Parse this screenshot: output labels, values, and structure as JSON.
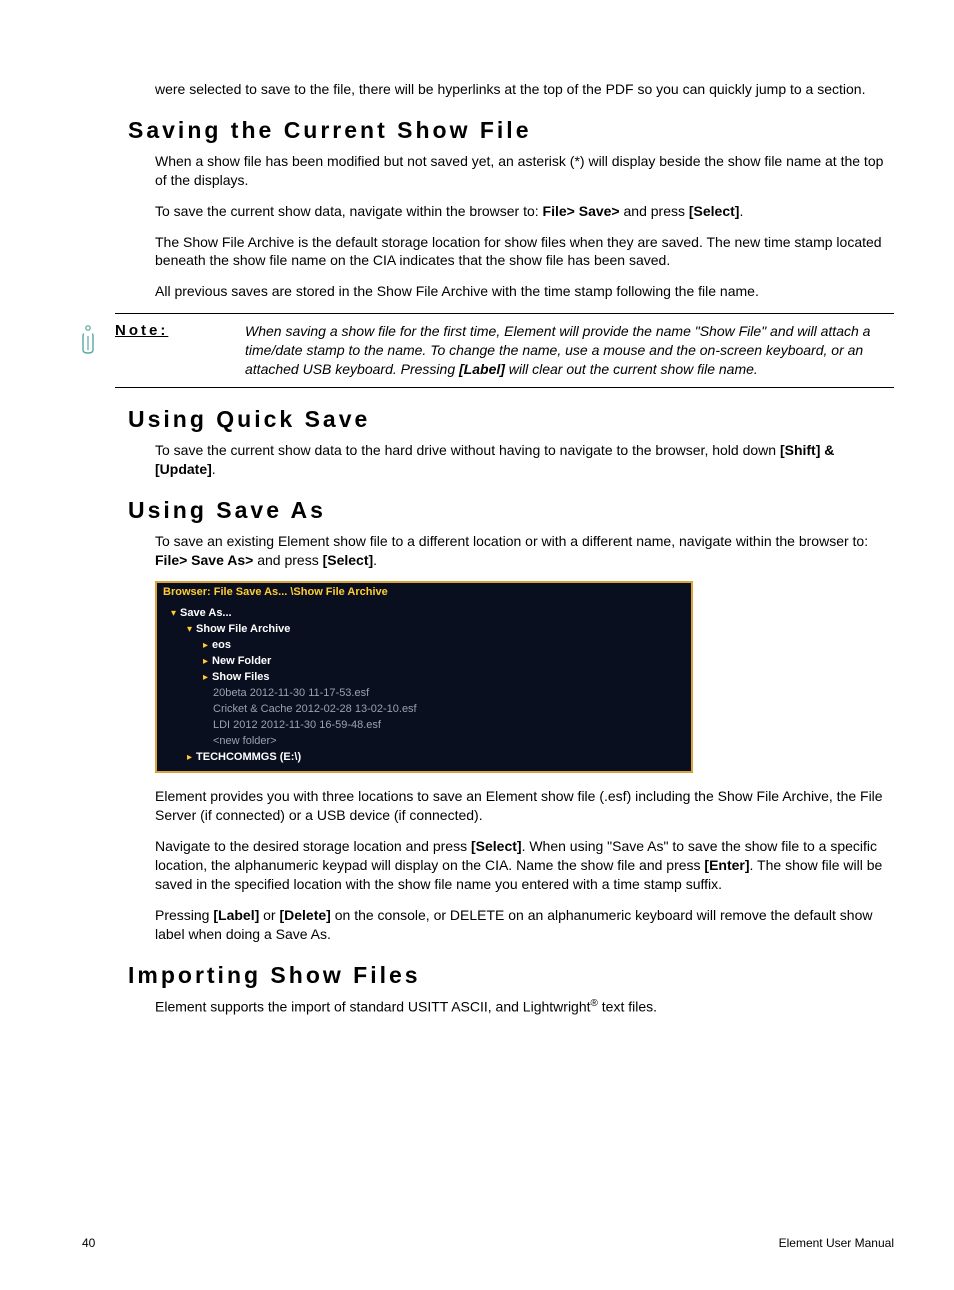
{
  "intro": {
    "p1": "were selected to save to the file, there will be hyperlinks at the top of the PDF so you can quickly jump to a section."
  },
  "saving": {
    "heading": "Saving the Current Show File",
    "p1": "When a show file has been modified but not saved yet, an asterisk (*) will display beside the show file name at the top of the displays.",
    "p2a": "To save the current show data, navigate within the browser to: ",
    "p2b": "File> Save>",
    "p2c": " and press ",
    "p2d": "[Select]",
    "p2e": ".",
    "p3": "The Show File Archive is the default storage location for show files when they are saved. The new time stamp located beneath the show file name on the CIA indicates that the show file has been saved.",
    "p4": "All previous saves are stored in the Show File Archive with the time stamp following the file name."
  },
  "note": {
    "label": "Note:",
    "body_a": "When saving a show file for the first time, Element will provide the name \"Show File\" and will attach a time/date stamp to the name. To change the name, use a mouse and the on-screen keyboard, or an attached USB keyboard. Pressing ",
    "body_b": "[Label]",
    "body_c": " will clear out the current show file name."
  },
  "quicksave": {
    "heading": "Using Quick Save",
    "p1a": "To save the current show data to the hard drive without having to navigate to the browser, hold down ",
    "p1b": "[Shift] & [Update]",
    "p1c": "."
  },
  "saveas": {
    "heading": "Using Save As",
    "p1a": "To save an existing Element show file to a different location or with a different name, navigate within the browser to: ",
    "p1b": "File> Save As>",
    "p1c": " and press ",
    "p1d": "[Select]",
    "p1e": ".",
    "p2": "Element provides you with three locations to save an Element show file (.esf) including the Show File Archive, the File Server (if connected) or a USB device (if connected).",
    "p3a": "Navigate to the desired storage location and press ",
    "p3b": "[Select]",
    "p3c": ". When using \"Save As\" to save the show file to a specific location, the alphanumeric keypad will display on the CIA. Name the show file and press ",
    "p3d": "[Enter]",
    "p3e": ". The show file will be saved in the specified location with the show file name you entered with a time stamp suffix.",
    "p4a": "Pressing ",
    "p4b": "[Label]",
    "p4c": " or ",
    "p4d": "[Delete]",
    "p4e": " on the console, or DELETE on an alphanumeric keyboard will remove the default show label when doing a Save As."
  },
  "browser": {
    "title": "Browser: File Save As... \\Show File Archive",
    "tree": {
      "save_as": "Save As...",
      "show_archive": "Show File Archive",
      "eos": "eos",
      "new_folder": "New Folder",
      "show_files": "Show Files",
      "file1": "20beta 2012-11-30 11-17-53.esf",
      "file2": "Cricket & Cache 2012-02-28 13-02-10.esf",
      "file3": "LDI 2012 2012-11-30 16-59-48.esf",
      "new_folder_angle": "<new folder>",
      "techcom": "TECHCOMMGS (E:\\)"
    }
  },
  "importing": {
    "heading": "Importing Show Files",
    "p1a": "Element supports the import of standard USITT ASCII, and Lightwright",
    "p1sup": "®",
    "p1b": " text files."
  },
  "footer": {
    "page": "40",
    "title": "Element User Manual"
  }
}
